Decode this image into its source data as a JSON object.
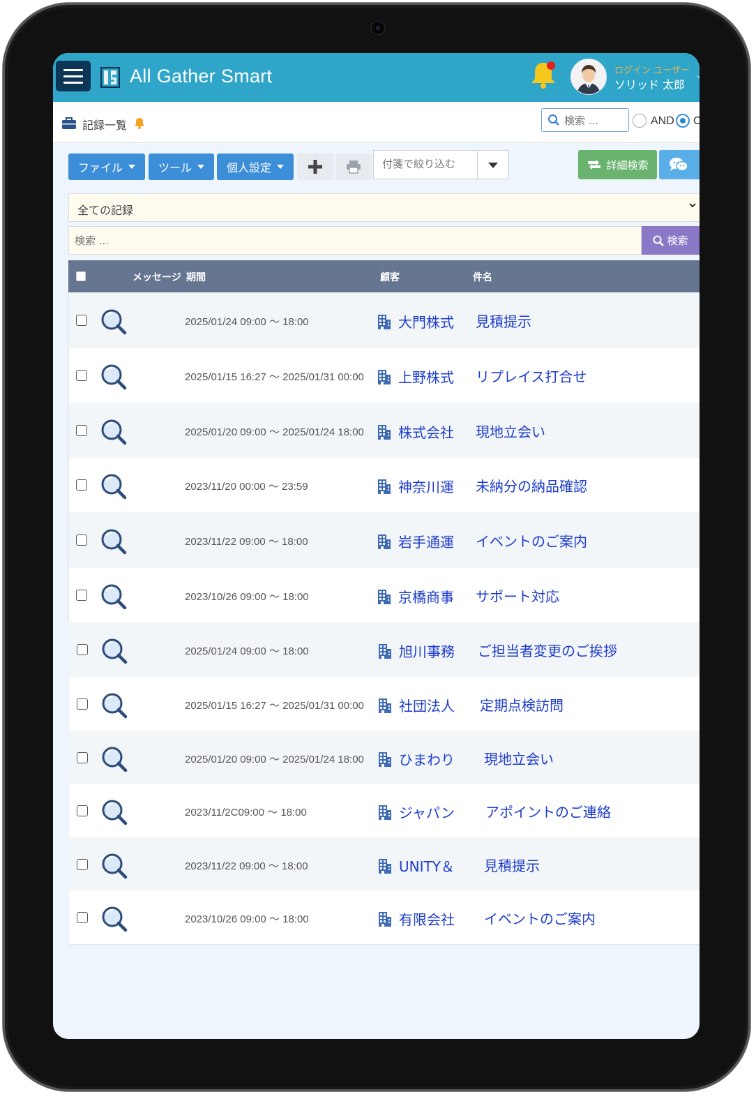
{
  "header": {
    "app_title": "All Gather Smart",
    "user_caption": "ログイン ユーザー",
    "user_name": "ソリッド 太郎",
    "notification": true
  },
  "subheader": {
    "page_title": "記録一覧",
    "search_placeholder": "検索 ...",
    "radio_and": "AND",
    "radio_or": "O",
    "selected_mode": "or"
  },
  "toolbar": {
    "file_label": "ファイル",
    "tool_label": "ツール",
    "personal_label": "個人設定",
    "tag_filter_placeholder": "付箋で絞り込む",
    "advanced_search_label": "詳細検索"
  },
  "filter": {
    "record_select_value": "全ての記録",
    "search_placeholder": "検索 ...",
    "search_button_label": "検索"
  },
  "table": {
    "columns": {
      "message": "メッセージ",
      "period": "期間",
      "customer": "顧客",
      "subject": "件名"
    },
    "rows": [
      {
        "period": "2025/01/24 09:00 〜 18:00",
        "customer": "大門株式",
        "subject": "見積提示"
      },
      {
        "period": "2025/01/15 16:27 〜 2025/01/31 00:00",
        "customer": "上野株式",
        "subject": "リプレイス打合せ"
      },
      {
        "period": "2025/01/20 09:00 〜 2025/01/24 18:00",
        "customer": "株式会社",
        "subject": "現地立会い"
      },
      {
        "period": "2023/11/20 00:00 〜 23:59",
        "customer": "神奈川運",
        "subject": "未納分の納品確認"
      },
      {
        "period": "2023/11/22 09:00 〜 18:00",
        "customer": "岩手通運",
        "subject": "イベントのご案内"
      },
      {
        "period": "2023/10/26 09:00 〜 18:00",
        "customer": "京橋商事",
        "subject": "サポート対応"
      },
      {
        "period": "2025/01/24 09:00 〜 18:00",
        "customer": "旭川事務",
        "subject": "ご担当者変更のご挨拶"
      },
      {
        "period": "2025/01/15 16:27 〜 2025/01/31 00:00",
        "customer": "社団法人",
        "subject": "定期点検訪問"
      },
      {
        "period": "2025/01/20 09:00 〜 2025/01/24 18:00",
        "customer": "ひまわり",
        "subject": "現地立会い"
      },
      {
        "period": "2023/11/2C09:00 〜 18:00",
        "customer": "ジャパン",
        "subject": "アポイントのご連絡"
      },
      {
        "period": "2023/11/22 09:00 〜 18:00",
        "customer": "UNITY＆",
        "subject": "見積提示"
      },
      {
        "period": "2023/10/26 09:00 〜 18:00",
        "customer": "有限会社",
        "subject": "イベントのご案内"
      }
    ]
  },
  "colors": {
    "header_bg": "#2fa6c9",
    "menu_button_bg": "#0d3555",
    "toolbar_button_bg": "#3d8ed8",
    "advanced_search_bg": "#6ab36e",
    "search_button_bg": "#8b78c6",
    "table_header_bg": "#667690",
    "link_blue": "#1d3ccc"
  },
  "icons": {
    "menu": "hamburger-icon",
    "logo": "app-logo-icon",
    "bell": "bell-icon",
    "avatar": "user-avatar",
    "briefcase": "briefcase-icon",
    "plus": "plus-icon",
    "print": "printer-icon",
    "refresh": "refresh-icon",
    "chat": "chat-icon",
    "magnifier": "search-icon",
    "building": "building-icon"
  }
}
